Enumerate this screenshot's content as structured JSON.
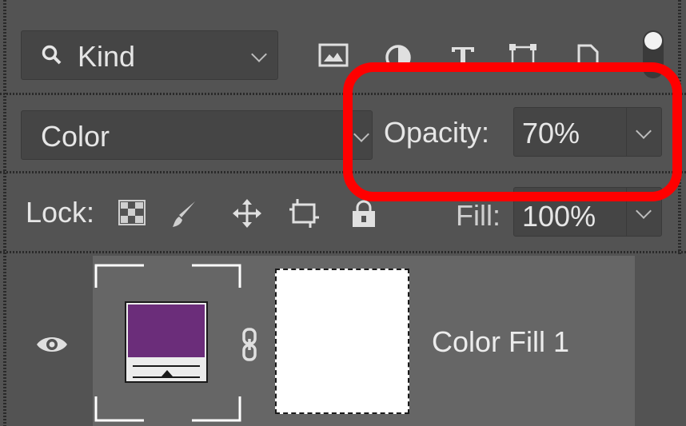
{
  "filter": {
    "kind_label": "Kind",
    "search_icon": "search-icon"
  },
  "blend": {
    "mode_label": "Color",
    "opacity_label": "Opacity:",
    "opacity_value": "70%"
  },
  "lock": {
    "lock_label": "Lock:",
    "fill_label": "Fill:",
    "fill_value": "100%"
  },
  "layer": {
    "name": "Color Fill 1",
    "fill_color": "#6b2d7a"
  },
  "highlight_color": "#ff0000"
}
